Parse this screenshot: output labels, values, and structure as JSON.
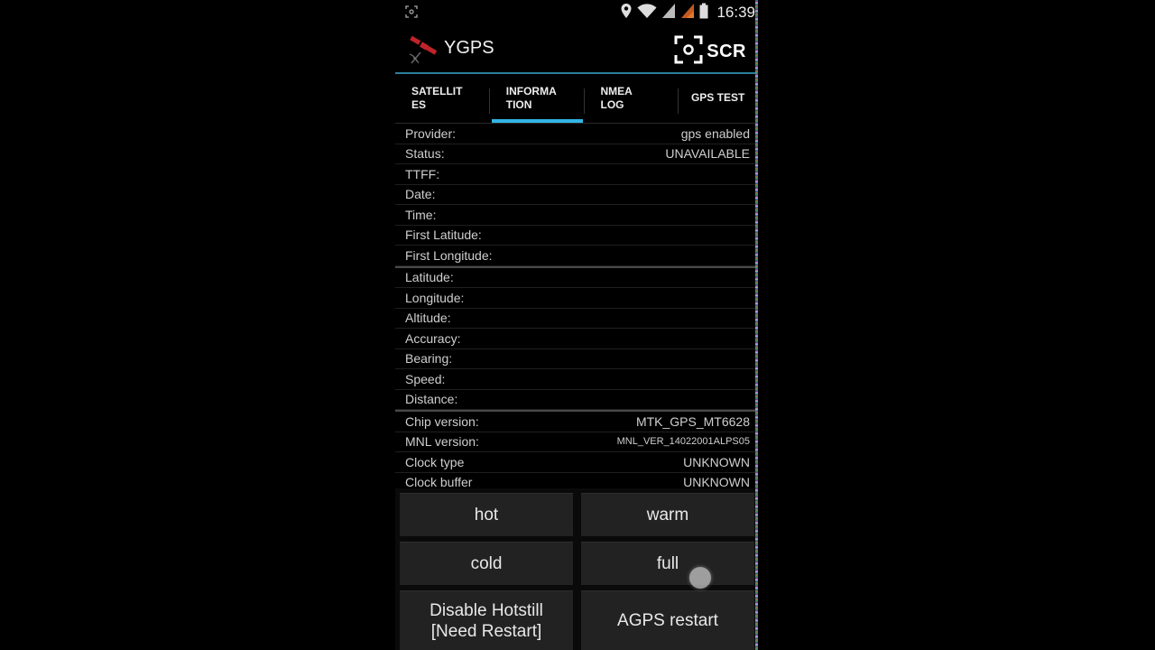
{
  "status_bar": {
    "time": "16:39",
    "icons": [
      "screenshot-icon",
      "location-icon",
      "wifi-icon",
      "signal-icon",
      "signal-2-icon",
      "battery-icon"
    ]
  },
  "action_bar": {
    "title": "YGPS",
    "scr_label": "SCR",
    "accent": "#2c7f9a"
  },
  "tabs": [
    {
      "label": "SATELLIT ES",
      "active": false
    },
    {
      "label": "INFORMA TION",
      "active": true
    },
    {
      "label": "NMEA LOG",
      "active": false
    },
    {
      "label": "GPS TEST",
      "active": false
    }
  ],
  "tab_indicator_color": "#33b5e5",
  "info": {
    "group1": [
      {
        "label": "Provider:",
        "value": "gps enabled"
      },
      {
        "label": "Status:",
        "value": "UNAVAILABLE"
      },
      {
        "label": "TTFF:",
        "value": ""
      },
      {
        "label": "Date:",
        "value": ""
      },
      {
        "label": "Time:",
        "value": ""
      },
      {
        "label": "First Latitude:",
        "value": ""
      },
      {
        "label": "First Longitude:",
        "value": ""
      }
    ],
    "group2": [
      {
        "label": "Latitude:",
        "value": ""
      },
      {
        "label": "Longitude:",
        "value": ""
      },
      {
        "label": "Altitude:",
        "value": ""
      },
      {
        "label": "Accuracy:",
        "value": ""
      },
      {
        "label": "Bearing:",
        "value": ""
      },
      {
        "label": "Speed:",
        "value": ""
      },
      {
        "label": "Distance:",
        "value": ""
      }
    ],
    "group3": [
      {
        "label": "Chip version:",
        "value": "MTK_GPS_MT6628"
      },
      {
        "label": "MNL version:",
        "value": "MNL_VER_14022001ALPS05"
      },
      {
        "label": "Clock type",
        "value": "UNKNOWN"
      },
      {
        "label": "Clock buffer",
        "value": "UNKNOWN"
      }
    ]
  },
  "buttons": {
    "hot": "hot",
    "warm": "warm",
    "cold": "cold",
    "full": "full",
    "disable_line1": "Disable Hotstill",
    "disable_line2": "[Need Restart]",
    "agps": "AGPS restart"
  }
}
